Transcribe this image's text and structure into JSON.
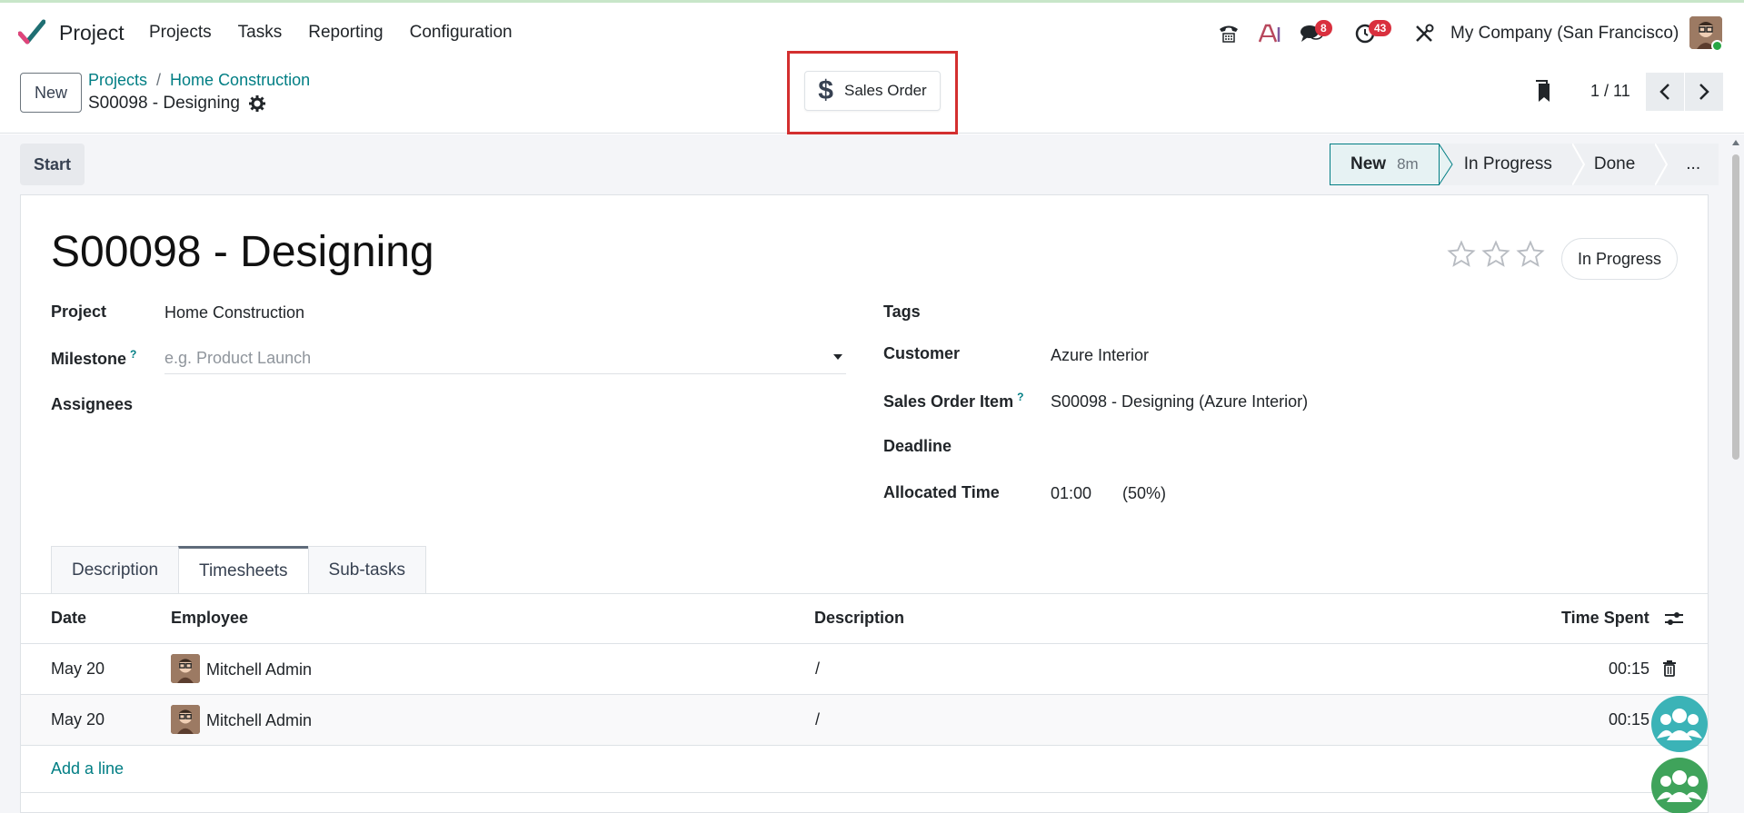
{
  "navbar": {
    "app_name": "Project",
    "menu": [
      "Projects",
      "Tasks",
      "Reporting",
      "Configuration"
    ],
    "messages_count": "8",
    "activities_count": "43",
    "company": "My Company (San Francisco)"
  },
  "control": {
    "new_label": "New",
    "breadcrumb": [
      "Projects",
      "Home Construction"
    ],
    "record_name": "S00098 - Designing",
    "smart_button": "Sales Order",
    "pager": "1 / 11"
  },
  "statusbar": {
    "start_label": "Start",
    "stages": [
      {
        "label": "New",
        "duration": "8m"
      },
      {
        "label": "In Progress"
      },
      {
        "label": "Done"
      },
      {
        "label": "..."
      }
    ]
  },
  "form": {
    "title": "S00098 - Designing",
    "state_label": "In Progress",
    "fields_left": {
      "project_label": "Project",
      "project_value": "Home Construction",
      "milestone_label": "Milestone",
      "milestone_placeholder": "e.g. Product Launch",
      "assignees_label": "Assignees"
    },
    "fields_right": {
      "tags_label": "Tags",
      "customer_label": "Customer",
      "customer_value": "Azure Interior",
      "so_item_label": "Sales Order Item",
      "so_item_value": "S00098 - Designing (Azure Interior)",
      "deadline_label": "Deadline",
      "allocated_label": "Allocated Time",
      "allocated_value": "01:00",
      "allocated_pct": "(50%)"
    },
    "help_mark": "?"
  },
  "tabs": [
    "Description",
    "Timesheets",
    "Sub-tasks"
  ],
  "timesheets": {
    "columns": [
      "Date",
      "Employee",
      "Description",
      "Time Spent"
    ],
    "rows": [
      {
        "date": "May 20",
        "employee": "Mitchell Admin",
        "description": "/",
        "time": "00:15"
      },
      {
        "date": "May 20",
        "employee": "Mitchell Admin",
        "description": "/",
        "time": "00:15"
      }
    ],
    "add_line": "Add a line"
  },
  "colors": {
    "accent": "#017e84",
    "badge": "#d9303e",
    "highlight": "#d32f2f"
  }
}
